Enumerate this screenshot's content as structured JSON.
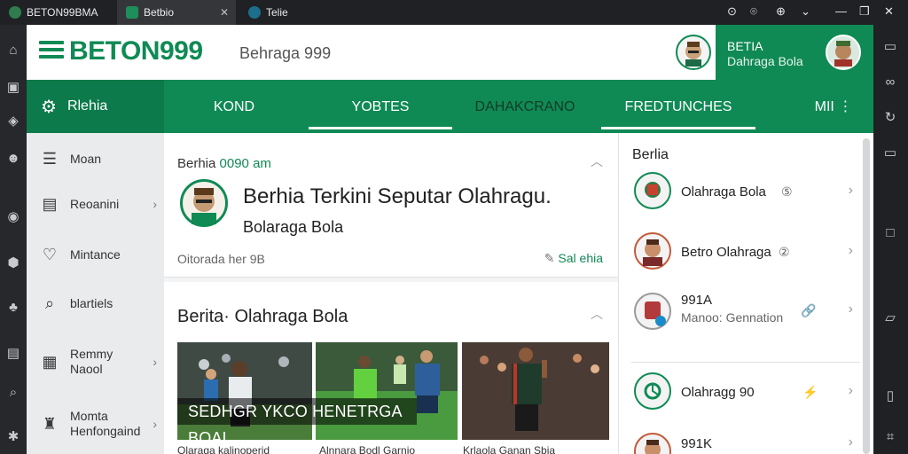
{
  "browser": {
    "tabs": [
      {
        "label": "BETON99BMA"
      },
      {
        "label": "Betbio"
      },
      {
        "label": "Telie"
      }
    ],
    "tab_close": "✕",
    "controls": [
      "⊙",
      "⌾",
      "⊕",
      "⌄",
      "—",
      "❐",
      "✕"
    ]
  },
  "header": {
    "logo": "BETON999",
    "subtitle": "Behraga 999",
    "account_name": "BETIA",
    "account_sub": "Dahraga Bola"
  },
  "nav": {
    "brand": "Rlehia",
    "items": [
      {
        "label": "KOND",
        "active": false
      },
      {
        "label": "YOBTES",
        "active": true
      },
      {
        "label": "DAHAKCRANO",
        "active": false
      },
      {
        "label": "FREDTUNCHES",
        "active": true
      },
      {
        "label": "MII ⋮",
        "active": false
      }
    ]
  },
  "sidebar": {
    "items": [
      {
        "label": "Moan",
        "icon": "list-icon"
      },
      {
        "label": "Reoanini",
        "icon": "document-icon"
      },
      {
        "label": "Mintance",
        "icon": "heart-icon"
      },
      {
        "label": "blartiels",
        "icon": "search-icon"
      },
      {
        "label": "Remmy Naool",
        "icon": "newspaper-icon"
      },
      {
        "label": "Momta Henfongaind",
        "icon": "trophy-icon"
      }
    ]
  },
  "main": {
    "featured": {
      "meta_prefix": "Berhia",
      "meta_time": "0090 am",
      "title": "Berhia Terkini Seputar Olahragu.",
      "subtitle": "Bolaraga Bola",
      "byline": "Oitorada her 9B",
      "tag": "Sal ehia"
    },
    "section": {
      "heading": "Berita· Olahraga Bola",
      "banner": "SEDHGR YKCO HENETRGA BOAL",
      "captions": [
        "Olaraga kalinoperid",
        "Alnnara Bodl Garnio",
        "Krlaola Ganan Sbia"
      ]
    }
  },
  "right_panel": {
    "heading": "Berlia",
    "items": [
      {
        "label": "Olahraga Bola",
        "badge": "⑤"
      },
      {
        "label": "Betro Olahraga",
        "badge": "②"
      },
      {
        "label": "991A",
        "sub": "Manoo: Gennation",
        "badge": "🔗"
      },
      {
        "label": "Olahragg 90",
        "badge": "⚡"
      },
      {
        "label": "991K",
        "badge": ""
      }
    ]
  },
  "colors": {
    "brand": "#0f8a54",
    "brand_dark": "#0c7a4a"
  }
}
